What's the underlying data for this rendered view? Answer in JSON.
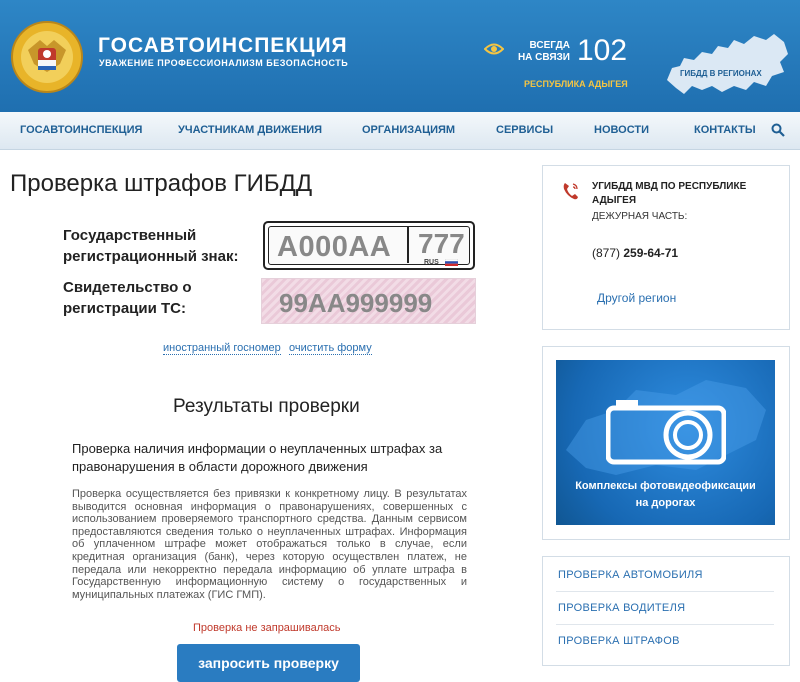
{
  "header": {
    "site_title": "ГОСАВТОИНСПЕКЦИЯ",
    "site_subtitle": "УВАЖЕНИЕ ПРОФЕССИОНАЛИЗМ БЕЗОПАСНОСТЬ",
    "always_line1": "ВСЕГДА",
    "always_line2": "НА СВЯЗИ",
    "hotline": "102",
    "region": "РЕСПУБЛИКА АДЫГЕЯ",
    "regions_label": "ГИБДД В РЕГИОНАХ",
    "brand_color": "#2579ba"
  },
  "nav": {
    "items": [
      {
        "label": "ГОСАВТОИНСПЕКЦИЯ"
      },
      {
        "label": "УЧАСТНИКАМ ДВИЖЕНИЯ"
      },
      {
        "label": "ОРГАНИЗАЦИЯМ"
      },
      {
        "label": "СЕРВИСЫ"
      },
      {
        "label": "НОВОСТИ"
      },
      {
        "label": "КОНТАКТЫ"
      }
    ],
    "search_icon": "search-icon"
  },
  "main": {
    "title": "Проверка штрафов ГИБДД",
    "reg_sign_label_1": "Государственный",
    "reg_sign_label_2": "регистрационный знак:",
    "plate_number": "А000АА",
    "plate_region": "777",
    "plate_country": "RUS",
    "cert_label_1": "Свидетельство о",
    "cert_label_2": "регистрации ТС:",
    "cert_number": "99АА999999",
    "foreign_link": "иностранный госномер",
    "clear_link": "очистить форму",
    "results_title": "Результаты проверки",
    "check_heading": "Проверка наличия информации о неуплаченных штрафах за правонарушения в области дорожного движения",
    "check_body": "Проверка осуществляется без привязки к конкретному лицу. В результатах выводится основная информация о правонарушениях, совершенных с использованием проверяемого транспортного средства. Данным сервисом предоставляются сведения только о неуплаченных штрафах. Информация об уплаченном штрафе может отображаться только в случае, если кредитная организация (банк), через которую осуществлен платеж, не передала или некорректно передала информацию об уплате штрафа в Государственную информационную систему о государственных и муниципальных платежах (ГИС ГМП).",
    "status": "Проверка не запрашивалась",
    "submit": "запросить проверку"
  },
  "sidebar": {
    "dept_line1": "УГИБДД МВД ПО РЕСПУБЛИКЕ",
    "dept_line2": "АДЫГЕЯ",
    "duty": "ДЕЖУРНАЯ ЧАСТЬ:",
    "phone_code": "(877)",
    "phone_number": "259-64-71",
    "other_region": "Другой регион",
    "banner_line1": "Комплексы фотовидеофиксации",
    "banner_line2": "на дорогах",
    "links": [
      {
        "label": "ПРОВЕРКА АВТОМОБИЛЯ"
      },
      {
        "label": "ПРОВЕРКА ВОДИТЕЛЯ"
      },
      {
        "label": "ПРОВЕРКА ШТРАФОВ"
      }
    ]
  }
}
